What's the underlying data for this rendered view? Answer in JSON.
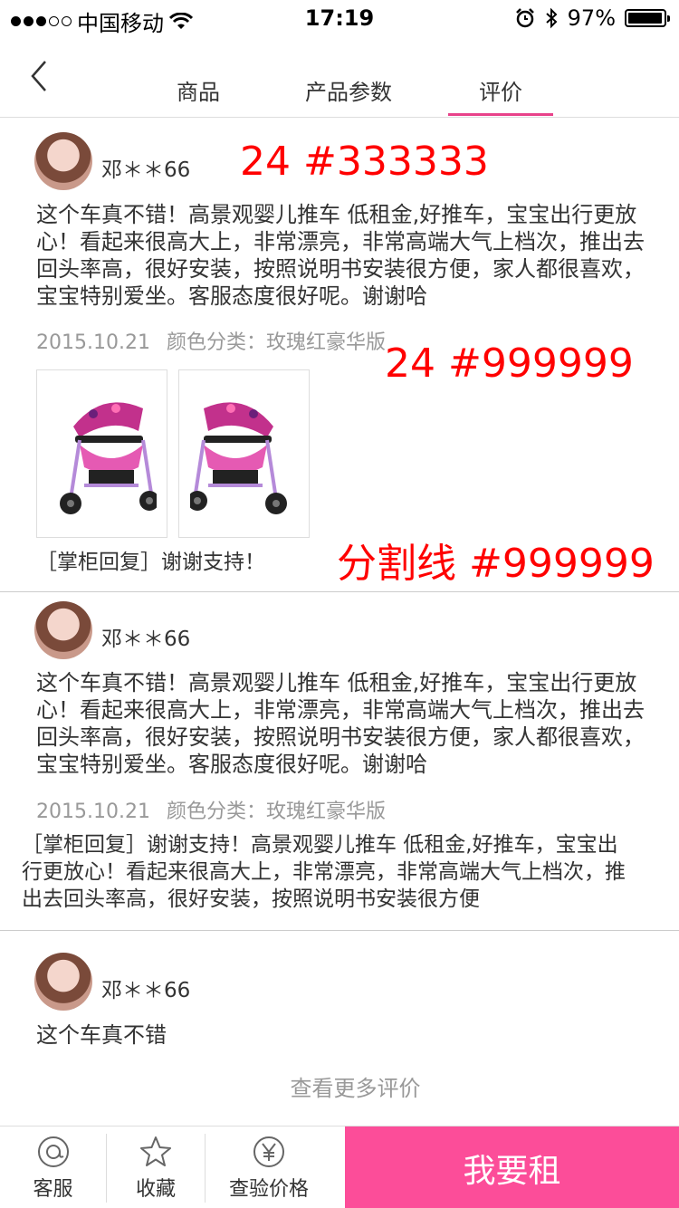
{
  "status_bar": {
    "carrier": "中国移动",
    "time": "17:19",
    "battery": "97%",
    "battery_level": 0.97
  },
  "nav": {
    "tabs": [
      "商品",
      "产品参数",
      "评价"
    ],
    "active_tab_index": 2
  },
  "annotations": {
    "text_spec": "24 #333333",
    "meta_spec": "24 #999999",
    "divider_spec": "分割线 #999999"
  },
  "reviews": [
    {
      "user": "邓＊＊66",
      "content": "这个车真不错！高景观婴儿推车 低租金,好推车，宝宝出行更放心！看起来很高大上，非常漂亮，非常高端大气上档次，推出去回头率高，很好安装，按照说明书安装很方便，家人都很喜欢，宝宝特别爱坐。客服态度很好呢。谢谢哈",
      "date": "2015.10.21",
      "color_label": "颜色分类：玫瑰红豪华版",
      "reply": "［掌柜回复］谢谢支持！"
    },
    {
      "user": "邓＊＊66",
      "content": "这个车真不错！高景观婴儿推车 低租金,好推车，宝宝出行更放心！看起来很高大上，非常漂亮，非常高端大气上档次，推出去回头率高，很好安装，按照说明书安装很方便，家人都很喜欢，宝宝特别爱坐。客服态度很好呢。谢谢哈",
      "date": "2015.10.21",
      "color_label": "颜色分类：玫瑰红豪华版",
      "reply": "［掌柜回复］谢谢支持！高景观婴儿推车 低租金,好推车，宝宝出行更放心！看起来很高大上，非常漂亮，非常高端大气上档次，推出去回头率高，很好安装，按照说明书安装很方便"
    },
    {
      "user": "邓＊＊66",
      "content": "这个车真不错"
    }
  ],
  "more_reviews": "查看更多评价",
  "bottom_bar": {
    "service": "客服",
    "favorite": "收藏",
    "price_check": "查验价格",
    "rent": "我要租"
  },
  "colors": {
    "accent": "#fc4d99",
    "tab_underline": "#e8428a",
    "text": "#333333",
    "meta": "#999999"
  }
}
